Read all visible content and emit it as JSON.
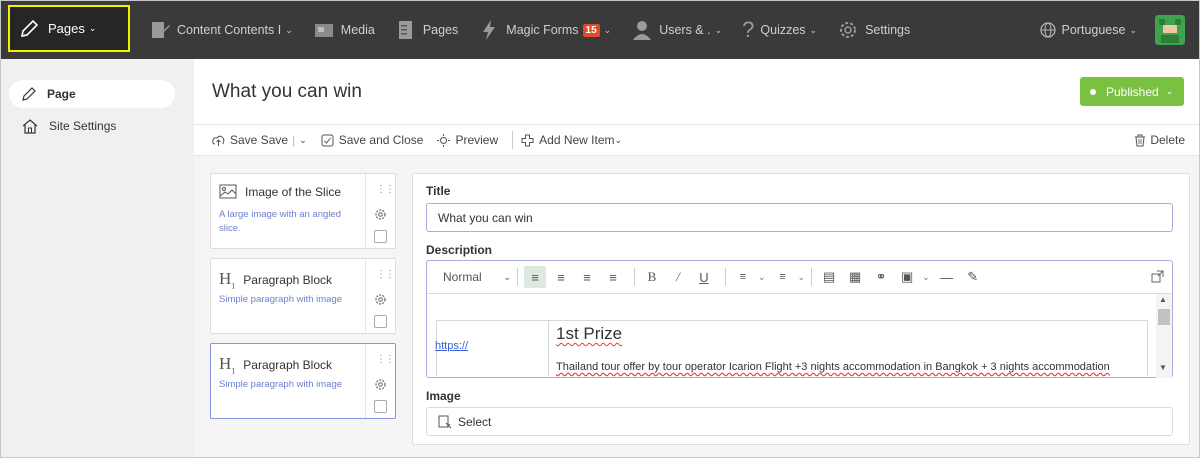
{
  "topnav": {
    "pages_label": "Pages",
    "items": [
      {
        "label": "Content Contents I"
      },
      {
        "label": "Media"
      },
      {
        "label": "Pages"
      },
      {
        "label": "Magic Forms",
        "badge": "15"
      },
      {
        "label": "Users & ."
      },
      {
        "label": "Quizzes"
      },
      {
        "label": "Settings"
      }
    ],
    "language": "Portuguese"
  },
  "sidebar": {
    "items": [
      {
        "label": "Page",
        "icon": "pencil-icon",
        "active": true
      },
      {
        "label": "Site Settings",
        "icon": "home-icon",
        "active": false
      }
    ]
  },
  "header": {
    "title": "What you can win",
    "status": "Published",
    "status_color": "#7ac142"
  },
  "toolbar": {
    "save": "Save Save",
    "save_close": "Save and Close",
    "preview": "Preview",
    "add_new_item": "Add New Item",
    "delete": "Delete"
  },
  "blocks": [
    {
      "title": "Image of the Slice",
      "description": "A large image with an angled slice.",
      "icon": "image-icon",
      "selected": false
    },
    {
      "title": "Paragraph Block",
      "description": "Simple paragraph with image",
      "icon": "heading-icon",
      "selected": false
    },
    {
      "title": "Paragraph Block",
      "description": "Simple paragraph with image",
      "icon": "heading-icon",
      "selected": true
    }
  ],
  "form": {
    "title_label": "Title",
    "title_value": "What you can win",
    "description_label": "Description",
    "format_value": "Normal",
    "content": {
      "link_text": "https://",
      "heading": "1st Prize",
      "body": "Thailand tour offer by tour operator Icarion Flight +3 nights accommodation in Bangkok + 3 nights accommodation"
    },
    "image_label": "Image",
    "image_select": "Select"
  }
}
